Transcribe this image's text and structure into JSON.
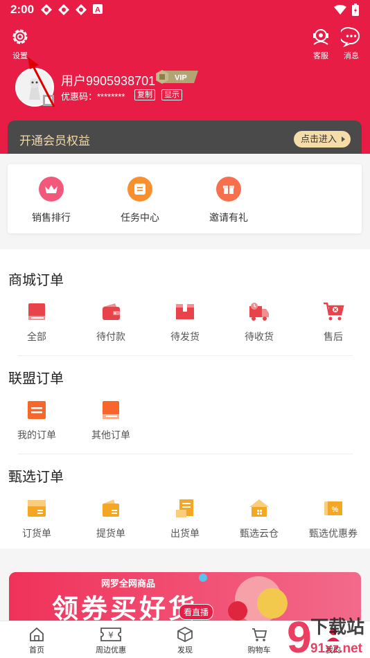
{
  "status_bar": {
    "time": "2:00"
  },
  "header": {
    "settings_label": "设置",
    "service_label": "客服",
    "messages_label": "消息",
    "username": "用户9905938701",
    "vip_badge": "VIP",
    "coupon_label": "优惠码：********",
    "copy_label": "复制",
    "show_label": "显示"
  },
  "member": {
    "title": "开通会员权益",
    "button": "点击进入"
  },
  "quick": [
    {
      "label": "销售排行",
      "color": "#f2587a"
    },
    {
      "label": "任务中心",
      "color": "#f9902f"
    },
    {
      "label": "邀请有礼",
      "color": "#f7704e"
    }
  ],
  "mall_orders": {
    "title": "商城订单",
    "items": [
      "全部",
      "待付款",
      "待发货",
      "待收货",
      "售后"
    ]
  },
  "alliance_orders": {
    "title": "联盟订单",
    "items": [
      "我的订单",
      "其他订单"
    ]
  },
  "select_orders": {
    "title": "甄选订单",
    "items": [
      "订货单",
      "提货单",
      "出货单",
      "甄选云仓",
      "甄选优惠券"
    ]
  },
  "banner": {
    "line1": "网罗全网商品",
    "line2": "领券买好货",
    "live": "看直播"
  },
  "bottom_nav": [
    "首页",
    "周边优惠",
    "发现",
    "购物车",
    "我的"
  ],
  "watermark": {
    "text": "下载站",
    "url": "91xz.net"
  },
  "colors": {
    "brand": "#e81d46",
    "orange": "#f5a623",
    "red_icon": "#e8424a"
  }
}
